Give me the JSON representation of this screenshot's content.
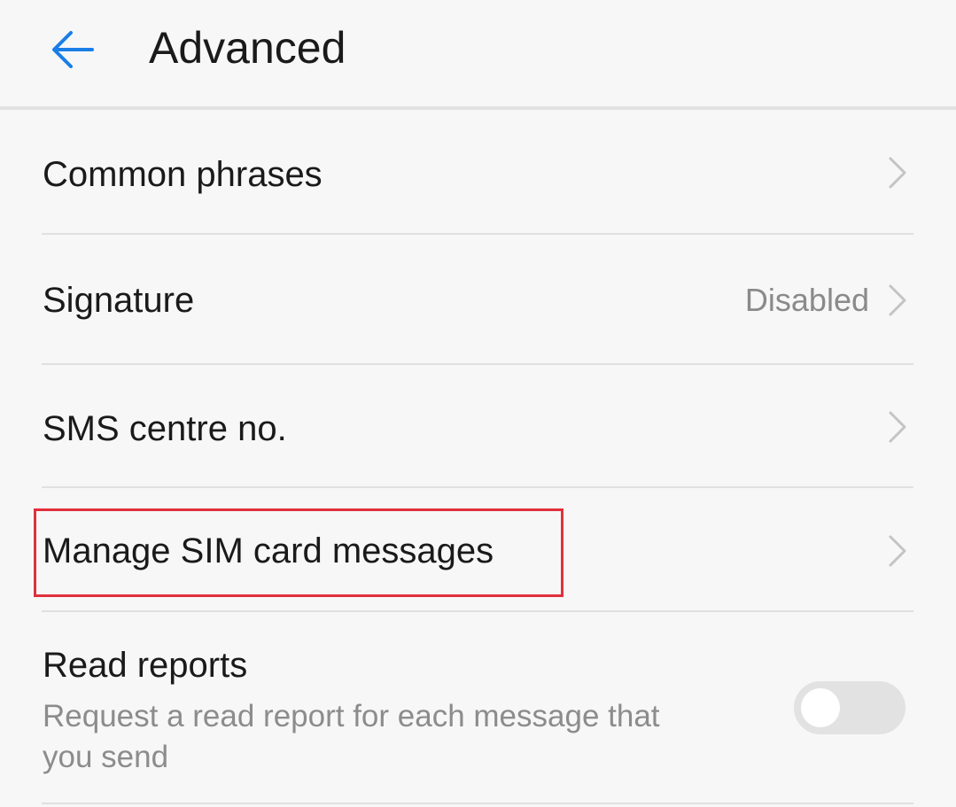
{
  "header": {
    "back_icon": "arrow-left-icon",
    "title": "Advanced"
  },
  "colors": {
    "accent": "#1a7ee6",
    "highlight": "#e0303b",
    "toggle_off": "#e2e2e2"
  },
  "settings": {
    "items": [
      {
        "label": "Common phrases",
        "value": "",
        "icon": "chevron-right-icon"
      },
      {
        "label": "Signature",
        "value": "Disabled",
        "icon": "chevron-right-icon"
      },
      {
        "label": "SMS centre no.",
        "value": "",
        "icon": "chevron-right-icon"
      },
      {
        "label": "Manage SIM card messages",
        "value": "",
        "icon": "chevron-right-icon"
      }
    ],
    "read_reports": {
      "label": "Read reports",
      "description_line1": "Request a read report for each message that",
      "description_line2": "you send",
      "enabled": false
    }
  }
}
